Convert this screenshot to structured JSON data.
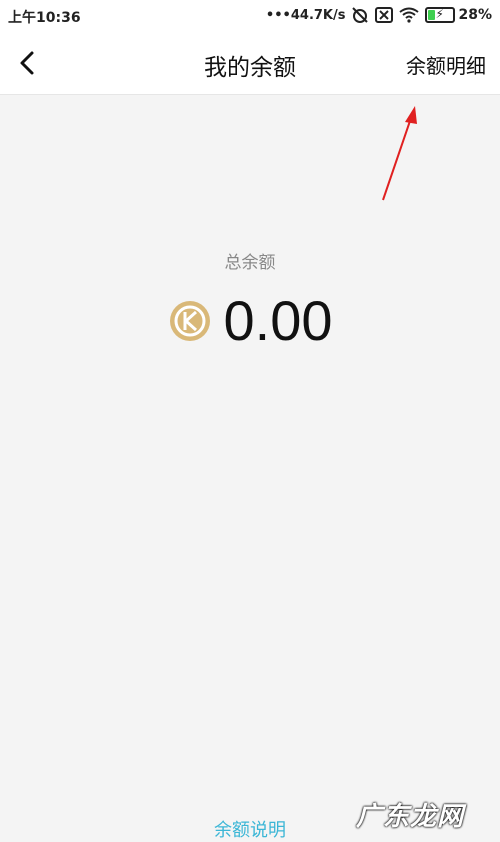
{
  "status_bar": {
    "time": "上午10:36",
    "speed": "•••44.7K/s",
    "battery_percent": "28%",
    "battery_level": 0.28
  },
  "header": {
    "title": "我的余额",
    "detail_label": "余额明细"
  },
  "balance": {
    "label": "总余额",
    "value": "0.00"
  },
  "footer": {
    "explanation_label": "余额说明"
  },
  "watermark": {
    "text": "广东龙网"
  },
  "colors": {
    "coin": "#d9b878",
    "link": "#3bb6d6",
    "annotation_arrow": "#e02020"
  }
}
